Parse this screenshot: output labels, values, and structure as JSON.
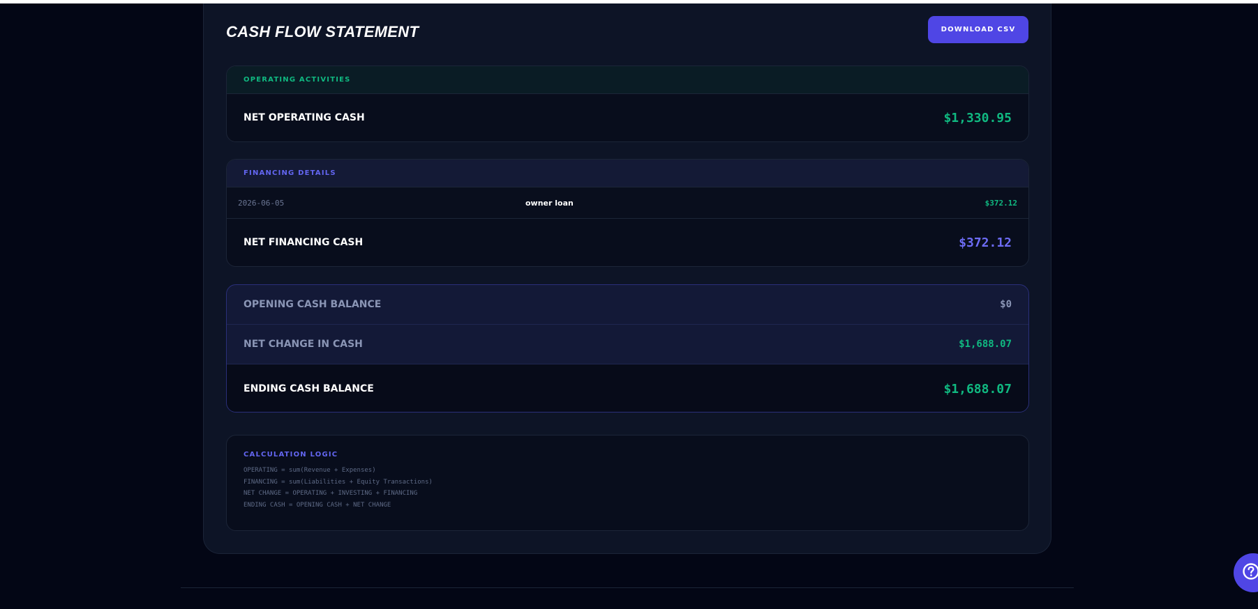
{
  "header": {
    "title": "CASH FLOW STATEMENT",
    "download_label": "DOWNLOAD CSV"
  },
  "operating": {
    "heading": "OPERATING ACTIVITIES",
    "total_label": "NET OPERATING CASH",
    "total_value": "$1,330.95"
  },
  "financing": {
    "heading": "FINANCING DETAILS",
    "rows": [
      {
        "date": "2026-06-05",
        "description": "owner loan",
        "amount": "$372.12"
      }
    ],
    "total_label": "NET FINANCING CASH",
    "total_value": "$372.12"
  },
  "summary": {
    "opening_label": "OPENING CASH BALANCE",
    "opening_value": "$0",
    "change_label": "NET CHANGE IN CASH",
    "change_value": "$1,688.07",
    "ending_label": "ENDING CASH BALANCE",
    "ending_value": "$1,688.07"
  },
  "logic": {
    "heading": "CALCULATION LOGIC",
    "lines": [
      "OPERATING = sum(Revenue + Expenses)",
      "FINANCING = sum(Liabilities + Equity Transactions)",
      "NET CHANGE = OPERATING + INVESTING + FINANCING",
      "ENDING CASH = OPENING CASH + NET CHANGE"
    ]
  },
  "colors": {
    "accent": "#4f46e5",
    "positive": "#10b981",
    "financing": "#6366f1"
  },
  "icons": {
    "help": "help-icon"
  }
}
